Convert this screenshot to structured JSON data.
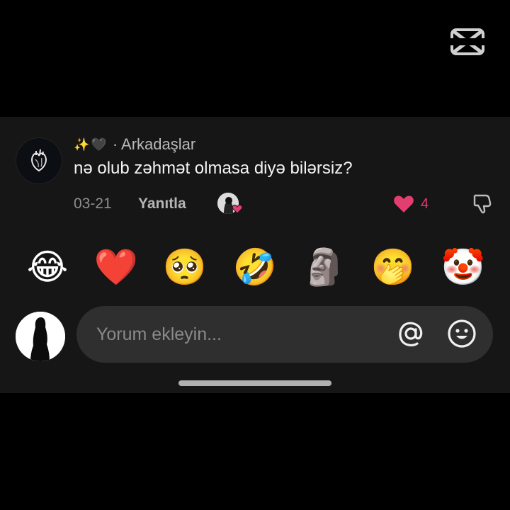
{
  "colors": {
    "background": "#000000",
    "panel": "#161616",
    "input": "#2f2f2f",
    "like": "#e23e6f",
    "muted_text": "#8e8e8e"
  },
  "watermark": {
    "icon": "capcut-logo-icon"
  },
  "comment": {
    "username_prefix": "✨🖤",
    "username": "· Arkadaşlar",
    "text": "nə olub zəhmət olmasa diyə bilərsiz?",
    "date": "03-21",
    "reply_label": "Yanıtla",
    "like_count": "4",
    "liked": true
  },
  "quick_reactions": [
    {
      "emoji": "😂",
      "icon": "tears-of-joy-emoji"
    },
    {
      "emoji": "❤️",
      "icon": "red-heart-emoji"
    },
    {
      "emoji": "🥺",
      "icon": "pleading-face-emoji"
    },
    {
      "emoji": "🤣",
      "icon": "rolling-laughing-emoji"
    },
    {
      "emoji": "🗿",
      "icon": "moai-emoji"
    },
    {
      "emoji": "🤭",
      "icon": "hand-over-mouth-emoji"
    },
    {
      "emoji": "🤡",
      "icon": "clown-face-emoji"
    }
  ],
  "input": {
    "placeholder": "Yorum ekleyin...",
    "value": ""
  }
}
